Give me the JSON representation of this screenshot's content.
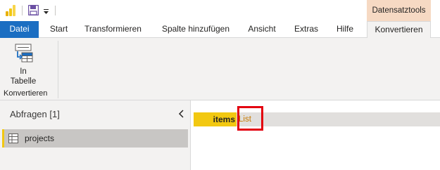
{
  "app": {
    "context_tab_header": "Datensatztools"
  },
  "tabs": [
    {
      "label": "Datei"
    },
    {
      "label": "Start"
    },
    {
      "label": "Transformieren"
    },
    {
      "label": "Spalte hinzufügen"
    },
    {
      "label": "Ansicht"
    },
    {
      "label": "Extras"
    },
    {
      "label": "Hilfe"
    },
    {
      "label": "Konvertieren"
    }
  ],
  "active_tab": "Konvertieren",
  "ribbon": {
    "in_table_button": {
      "line1": "In",
      "line2": "Tabelle",
      "icon": "list-to-table-icon"
    },
    "group_label": "Konvertieren"
  },
  "queries": {
    "title": "Abfragen [1]",
    "items": [
      {
        "label": "projects",
        "icon": "table-icon"
      }
    ]
  },
  "grid": {
    "header": "items",
    "value": "List"
  },
  "colors": {
    "file_tab": "#1b6ec2",
    "context_header": "#f6d9c3",
    "accent_yellow": "#f2c811",
    "highlight_box": "#e3000f",
    "list_link": "#c77a00"
  }
}
